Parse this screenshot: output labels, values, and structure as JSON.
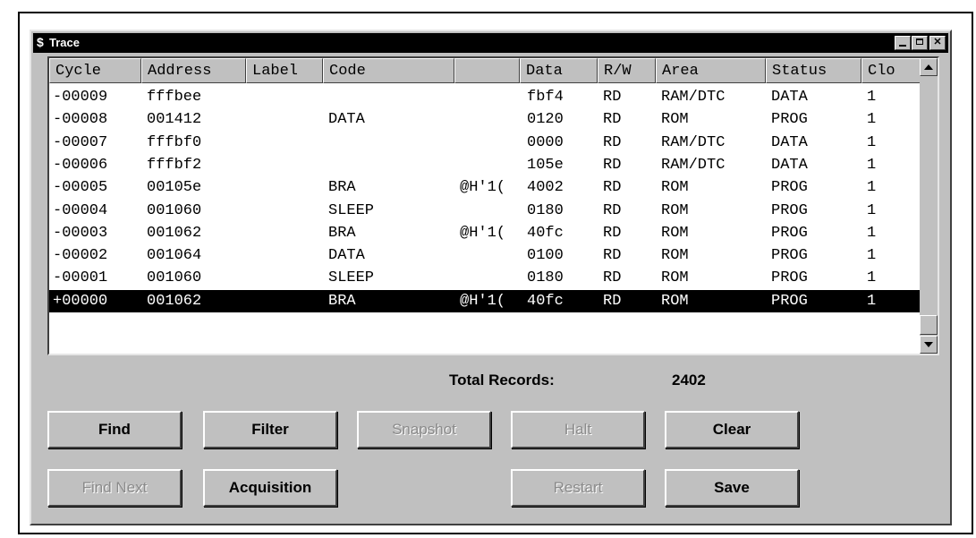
{
  "window": {
    "title": "Trace"
  },
  "table": {
    "headers": [
      "Cycle",
      "Address",
      "Label",
      "Code",
      "",
      "Data",
      "R/W",
      "Area",
      "Status",
      "Clo"
    ],
    "rows": [
      [
        "-00009",
        "fffbee",
        "",
        "",
        "",
        "fbf4",
        "RD",
        "RAM/DTC",
        "DATA",
        "1"
      ],
      [
        "-00008",
        "001412",
        "",
        "DATA",
        "",
        "0120",
        "RD",
        "ROM",
        "PROG",
        "1"
      ],
      [
        "-00007",
        "fffbf0",
        "",
        "",
        "",
        "0000",
        "RD",
        "RAM/DTC",
        "DATA",
        "1"
      ],
      [
        "-00006",
        "fffbf2",
        "",
        "",
        "",
        "105e",
        "RD",
        "RAM/DTC",
        "DATA",
        "1"
      ],
      [
        "-00005",
        "00105e",
        "",
        "BRA",
        "@H'1(",
        "4002",
        "RD",
        "ROM",
        "PROG",
        "1"
      ],
      [
        "-00004",
        "001060",
        "",
        "SLEEP",
        "",
        "0180",
        "RD",
        "ROM",
        "PROG",
        "1"
      ],
      [
        "-00003",
        "001062",
        "",
        "BRA",
        "@H'1(",
        "40fc",
        "RD",
        "ROM",
        "PROG",
        "1"
      ],
      [
        "-00002",
        "001064",
        "",
        "DATA",
        "",
        "0100",
        "RD",
        "ROM",
        "PROG",
        "1"
      ],
      [
        "-00001",
        "001060",
        "",
        "SLEEP",
        "",
        "0180",
        "RD",
        "ROM",
        "PROG",
        "1"
      ],
      [
        "+00000",
        "001062",
        "",
        "BRA",
        "@H'1(",
        "40fc",
        "RD",
        "ROM",
        "PROG",
        "1"
      ]
    ],
    "selected_row": 9
  },
  "summary": {
    "total_label": "Total Records:",
    "total_value": "2402"
  },
  "buttons": {
    "find": "Find",
    "filter": "Filter",
    "snapshot": "Snapshot",
    "halt": "Halt",
    "clear": "Clear",
    "find_next": "Find Next",
    "acquisition": "Acquisition",
    "restart": "Restart",
    "save": "Save"
  }
}
